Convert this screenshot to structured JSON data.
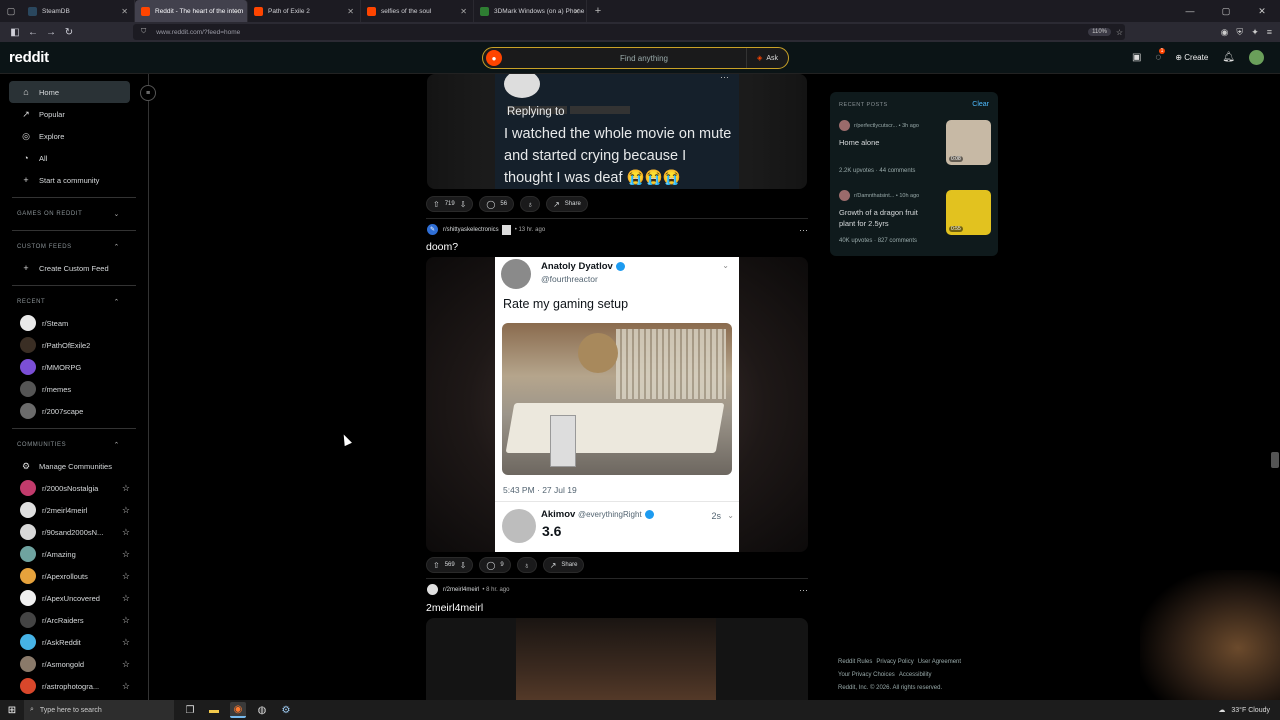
{
  "browser": {
    "tabs": [
      {
        "title": "SteamDB",
        "color": "#2a475e"
      },
      {
        "title": "Reddit - The heart of the intern",
        "color": "#ff4500",
        "active": true
      },
      {
        "title": "Path of Exile 2",
        "color": "#ff4500"
      },
      {
        "title": "selfies of the soul",
        "color": "#ff4500"
      },
      {
        "title": "3DMark Windows (on a) Phone",
        "color": "#2e7d32"
      }
    ],
    "url": "www.reddit.com/?feed=home",
    "zoom": "110%"
  },
  "header": {
    "logo": "reddit",
    "search_placeholder": "Find anything",
    "ask_label": "Ask",
    "create_label": "Create",
    "chat_badge": "1"
  },
  "sidebar": {
    "nav": [
      {
        "label": "Home",
        "icon": "home-icon",
        "glyph": "⌂"
      },
      {
        "label": "Popular",
        "icon": "popular-icon",
        "glyph": "↗"
      },
      {
        "label": "Explore",
        "icon": "explore-icon",
        "glyph": "◎"
      },
      {
        "label": "All",
        "icon": "all-icon",
        "glyph": "◔"
      },
      {
        "label": "Start a community",
        "icon": "plus-icon",
        "glyph": "+"
      }
    ],
    "games_header": "GAMES ON REDDIT",
    "custom_feeds_header": "CUSTOM FEEDS",
    "create_custom_feed": "Create Custom Feed",
    "recent_header": "RECENT",
    "recent": [
      {
        "label": "r/Steam",
        "color": "#e9e9e9"
      },
      {
        "label": "r/PathOfExile2",
        "color": "#3a2e24"
      },
      {
        "label": "r/MMORPG",
        "color": "#7b4fd6"
      },
      {
        "label": "r/memes",
        "color": "#555555"
      },
      {
        "label": "r/2007scape",
        "color": "#6b6b6b"
      }
    ],
    "communities_header": "COMMUNITIES",
    "manage_communities": "Manage Communities",
    "communities": [
      {
        "label": "r/2000sNostalgia",
        "color": "#c23b6c"
      },
      {
        "label": "r/2meirl4meirl",
        "color": "#e0e0e0"
      },
      {
        "label": "r/90sand2000sN...",
        "color": "#d8d8d8"
      },
      {
        "label": "r/Amazing",
        "color": "#6fa3a0"
      },
      {
        "label": "r/Apexrollouts",
        "color": "#e6a23c"
      },
      {
        "label": "r/ApexUncovered",
        "color": "#f0f0f0"
      },
      {
        "label": "r/ArcRaiders",
        "color": "#444444"
      },
      {
        "label": "r/AskReddit",
        "color": "#46b3e6"
      },
      {
        "label": "r/Asmongold",
        "color": "#8a7a6a"
      },
      {
        "label": "r/astrophotogra...",
        "color": "#d9472b"
      }
    ]
  },
  "feed": {
    "post1": {
      "reply_to": "Replying to",
      "text": "I watched the whole movie on mute and started crying because I thought I was deaf 😭😭😭",
      "upvotes": "719",
      "comments": "56",
      "share": "Share"
    },
    "post2": {
      "subreddit": "r/shittyaskelectronics",
      "age": "13 hr. ago",
      "title": "doom?",
      "tweet_name": "Anatoly Dyatlov",
      "tweet_handle": "@fourthreactor",
      "tweet_text": "Rate my gaming setup",
      "tweet_time": "5:43 PM · 27 Jul 19",
      "reply_name": "Akimov",
      "reply_handle": "@everythingRight",
      "reply_age": "2s",
      "reply_score": "3.6",
      "upvotes": "569",
      "comments": "9",
      "share": "Share"
    },
    "post3": {
      "subreddit": "r/2meirl4meirl",
      "age": "8 hr. ago",
      "title": "2meirl4meirl"
    }
  },
  "recent_posts": {
    "header": "RECENT POSTS",
    "clear": "Clear",
    "items": [
      {
        "sub": "r/perfectlycutscr...",
        "age": "3h ago",
        "title": "Home alone",
        "stats": "2.2K upvotes · 44 comments",
        "duration": "0:08",
        "thumb": "#c7b9a5"
      },
      {
        "sub": "r/Damnthatsint...",
        "age": "10h ago",
        "title": "Growth of a dragon fruit plant for 2.5yrs",
        "stats": "40K upvotes · 827 comments",
        "duration": "0:55",
        "thumb": "#e2c21f"
      }
    ]
  },
  "footer": {
    "links": [
      "Reddit Rules",
      "Privacy Policy",
      "User Agreement",
      "Your Privacy Choices",
      "Accessibility"
    ],
    "copyright": "Reddit, Inc. © 2026. All rights reserved."
  },
  "taskbar": {
    "search_placeholder": "Type here to search",
    "weather": "33°F  Cloudy"
  }
}
